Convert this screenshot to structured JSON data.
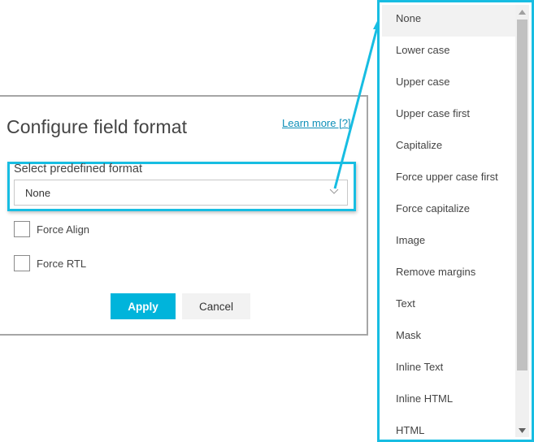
{
  "panel": {
    "title": "Configure field format",
    "learn_more": "Learn more [?]",
    "select_label": "Select predefined format",
    "select_value": "None",
    "checkboxes": [
      {
        "label": "Force Align",
        "checked": false
      },
      {
        "label": "Force RTL",
        "checked": false
      }
    ],
    "apply_label": "Apply",
    "cancel_label": "Cancel"
  },
  "dropdown": {
    "selected": "None",
    "items": [
      "None",
      "Lower case",
      "Upper case",
      "Upper case first",
      "Capitalize",
      "Force upper case first",
      "Force capitalize",
      "Image",
      "Remove margins",
      "Text",
      "Mask",
      "Inline Text",
      "Inline HTML",
      "HTML"
    ]
  },
  "colors": {
    "highlight": "#17bde2",
    "primary_button": "#00b4db",
    "link": "#0e8fb8"
  }
}
